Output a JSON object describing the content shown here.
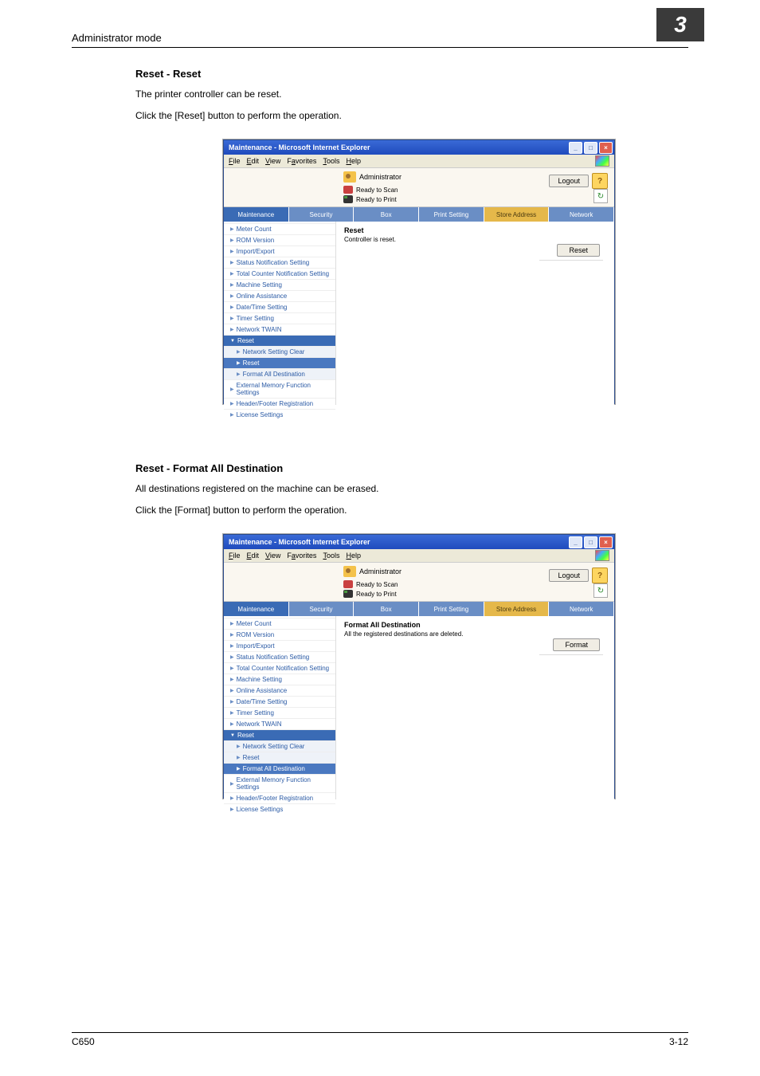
{
  "header": {
    "title": "Administrator mode",
    "chapter": "3"
  },
  "section1": {
    "heading": "Reset - Reset",
    "line1": "The printer controller can be reset.",
    "line2": "Click the [Reset] button to perform the operation."
  },
  "section2": {
    "heading": "Reset - Format All Destination",
    "line1": "All destinations registered on the machine can be erased.",
    "line2": "Click the [Format] button to perform the operation."
  },
  "browser": {
    "title": "Maintenance - Microsoft Internet Explorer",
    "menus": {
      "file": "File",
      "edit": "Edit",
      "view": "View",
      "favorites": "Favorites",
      "tools": "Tools",
      "help": "Help"
    },
    "administrator": "Administrator",
    "ready_scan": "Ready to Scan",
    "ready_print": "Ready to Print",
    "logout": "Logout",
    "help": "?",
    "refresh": "↻",
    "tabs": {
      "maintenance": "Maintenance",
      "security": "Security",
      "box": "Box",
      "print": "Print Setting",
      "store": "Store Address",
      "network": "Network"
    },
    "sidebar": [
      "Meter Count",
      "ROM Version",
      "Import/Export",
      "Status Notification Setting",
      "Total Counter Notification Setting",
      "Machine Setting",
      "Online Assistance",
      "Date/Time Setting",
      "Timer Setting",
      "Network TWAIN"
    ],
    "reset_header": "Reset",
    "reset_subs": {
      "clear": "Network Setting Clear",
      "reset": "Reset",
      "format": "Format All Destination"
    },
    "sidebar_after": [
      "External Memory Function Settings",
      "Header/Footer Registration",
      "License Settings"
    ]
  },
  "panel1": {
    "title": "Reset",
    "text": "Controller is reset.",
    "button": "Reset"
  },
  "panel2": {
    "title": "Format All Destination",
    "text": "All the registered destinations are deleted.",
    "button": "Format"
  },
  "footer": {
    "left": "C650",
    "right": "3-12"
  }
}
